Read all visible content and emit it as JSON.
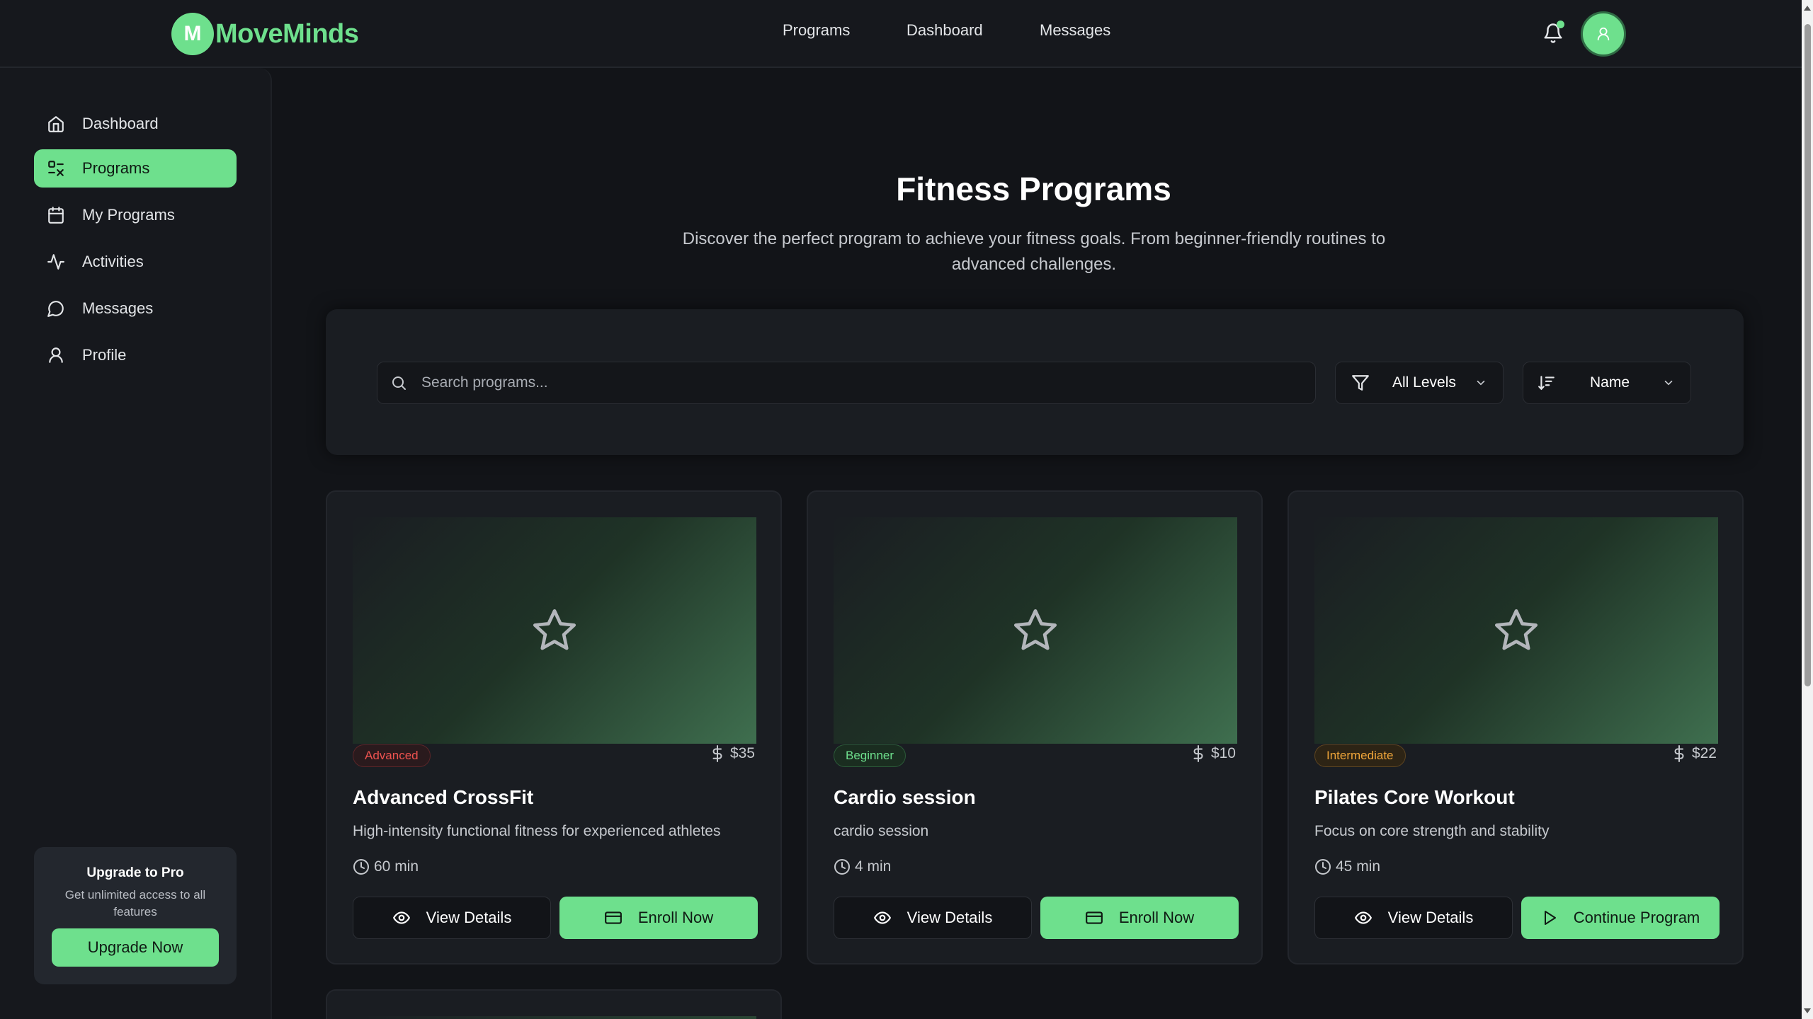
{
  "brand": {
    "logo_letter": "M",
    "name": "MoveMinds",
    "color": "#6ee08d"
  },
  "topnav": {
    "links": [
      "Programs",
      "Dashboard",
      "Messages"
    ]
  },
  "sidebar": {
    "items": [
      {
        "label": "Dashboard",
        "icon": "home-icon"
      },
      {
        "label": "Programs",
        "icon": "programs-icon",
        "active": true
      },
      {
        "label": "My Programs",
        "icon": "calendar-icon"
      },
      {
        "label": "Activities",
        "icon": "activity-icon"
      },
      {
        "label": "Messages",
        "icon": "message-icon"
      },
      {
        "label": "Profile",
        "icon": "user-icon"
      }
    ],
    "upgrade": {
      "title": "Upgrade to Pro",
      "subtitle": "Get unlimited access to all features",
      "button": "Upgrade Now"
    }
  },
  "main": {
    "title": "Fitness Programs",
    "subtitle": "Discover the perfect program to achieve your fitness goals. From beginner-friendly routines to advanced challenges.",
    "search": {
      "placeholder": "Search programs..."
    },
    "level_filter": {
      "value": "All Levels"
    },
    "sort": {
      "value": "Name"
    }
  },
  "programs": [
    {
      "level": "Advanced",
      "price": "$35",
      "title": "Advanced CrossFit",
      "description": "High-intensity functional fitness for experienced athletes",
      "duration": "60 min",
      "details_label": "View Details",
      "action_label": "Enroll Now"
    },
    {
      "level": "Beginner",
      "price": "$10",
      "title": "Cardio session",
      "description": "cardio session",
      "duration": "4 min",
      "details_label": "View Details",
      "action_label": "Enroll Now"
    },
    {
      "level": "Intermediate",
      "price": "$22",
      "title": "Pilates Core Workout",
      "description": "Focus on core strength and stability",
      "duration": "45 min",
      "details_label": "View Details",
      "action_label": "Continue Program"
    }
  ],
  "colors": {
    "accent": "#6ee08d",
    "background": "#121418",
    "advanced": "#ef5350",
    "beginner": "#6ee08d",
    "intermediate": "#f0a63a"
  }
}
